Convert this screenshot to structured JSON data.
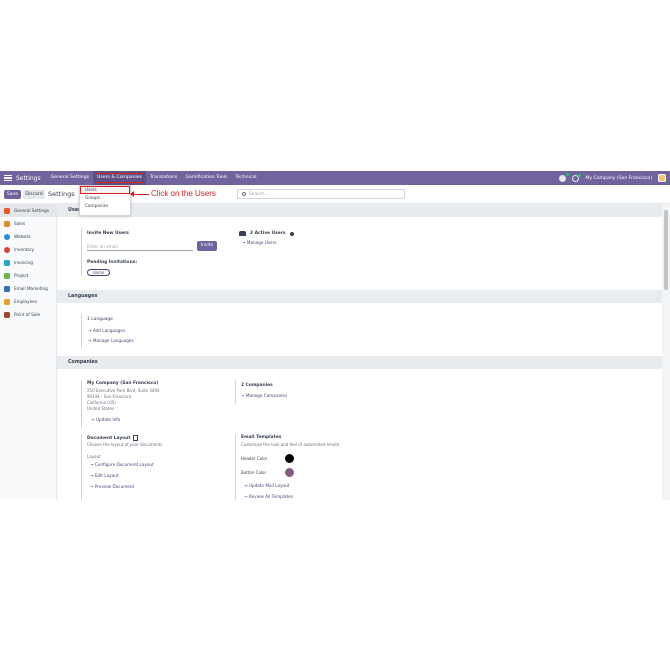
{
  "navbar": {
    "brand": "Settings",
    "menu": [
      "General Settings",
      "Users & Companies",
      "Translations",
      "Gamification Tools",
      "Technical"
    ],
    "company": "My Company (San Francisco)"
  },
  "control": {
    "save": "Save",
    "discard": "Discard",
    "title": "Settings",
    "search_placeholder": "Search..."
  },
  "dropdown": {
    "items": [
      "Users",
      "Groups",
      "Companies"
    ]
  },
  "annotation": "Click on the Users",
  "sidebar": {
    "items": [
      {
        "label": "General Settings",
        "color": "#e2592a"
      },
      {
        "label": "Sales",
        "color": "#e08b33"
      },
      {
        "label": "Website",
        "color": "#2b8fd6"
      },
      {
        "label": "Inventory",
        "color": "#d6453a"
      },
      {
        "label": "Invoicing",
        "color": "#2aa3c9"
      },
      {
        "label": "Project",
        "color": "#6db34d"
      },
      {
        "label": "Email Marketing",
        "color": "#2f6fb5"
      },
      {
        "label": "Employees",
        "color": "#e6a02f"
      },
      {
        "label": "Point of Sale",
        "color": "#9c4a2f"
      }
    ]
  },
  "users": {
    "section_fragment": "User",
    "invite_title": "Invite New Users",
    "email_placeholder": "Enter an email",
    "invite_button": "Invite",
    "pending_title": "Pending Invitations:",
    "pending_chip": "demo",
    "active_users": "2 Active Users",
    "manage_users": "Manage Users"
  },
  "languages": {
    "section": "Languages",
    "count": "1 Language",
    "add": "Add Languages",
    "manage": "Manage Languages"
  },
  "companies": {
    "section": "Companies",
    "company_name": "My Company (San Francisco)",
    "address": [
      "250 Executive Park Blvd, Suite 3400",
      "94134 - San Francisco",
      "California (US)",
      "United States"
    ],
    "update_info": "Update Info",
    "count": "2 Companies",
    "manage": "Manage Companies",
    "doc_layout_title": "Document Layout",
    "doc_layout_sub": "Choose the layout of your documents",
    "layout_label": "Layout",
    "configure_layout": "Configure Document Layout",
    "edit_layout": "Edit Layout",
    "preview": "Preview Document",
    "email_templates_title": "Email Templates",
    "email_templates_sub": "Customize the look and feel of automated emails",
    "header_color_label": "Header Color",
    "header_color": "#000000",
    "button_color_label": "Button Color",
    "button_color": "#875a7b",
    "update_mail_layout": "Update Mail Layout",
    "review_templates": "Review All Templates"
  }
}
